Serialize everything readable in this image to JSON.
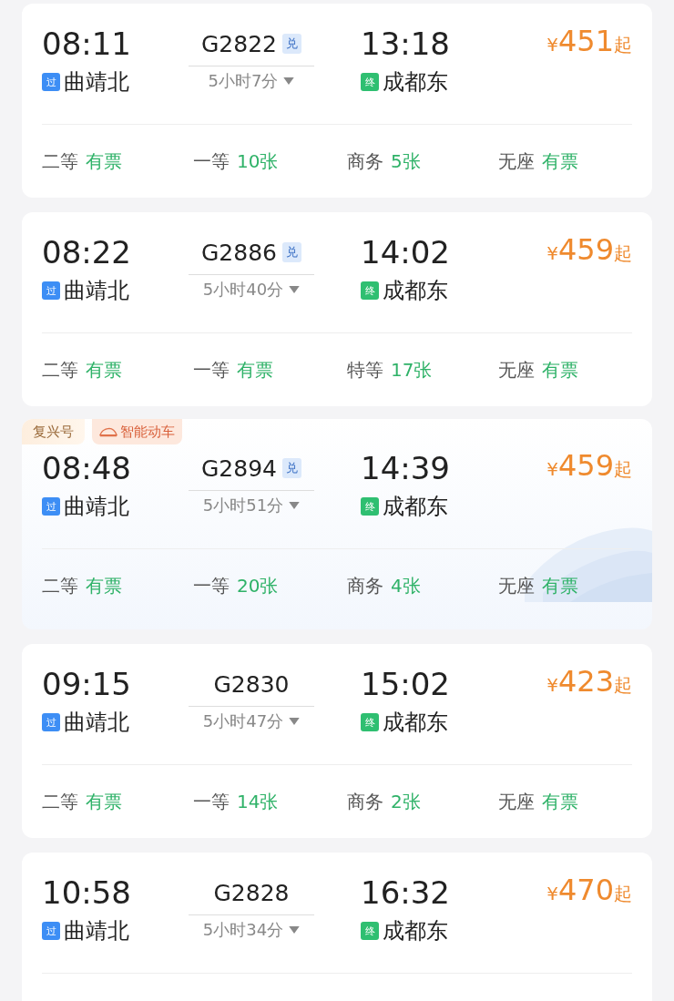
{
  "trains": [
    {
      "depart": "08:11",
      "number": "G2822",
      "badge": "兑",
      "arrive": "13:18",
      "from_tag": "过",
      "from": "曲靖北",
      "duration": "5小时7分",
      "to_tag": "终",
      "to": "成都东",
      "currency": "¥",
      "price": "451",
      "price_suffix": "起",
      "seats": [
        {
          "label": "二等",
          "availability": "有票"
        },
        {
          "label": "一等",
          "availability": "10张"
        },
        {
          "label": "商务",
          "availability": "5张"
        },
        {
          "label": "无座",
          "availability": "有票"
        }
      ]
    },
    {
      "depart": "08:22",
      "number": "G2886",
      "badge": "兑",
      "arrive": "14:02",
      "from_tag": "过",
      "from": "曲靖北",
      "duration": "5小时40分",
      "to_tag": "终",
      "to": "成都东",
      "currency": "¥",
      "price": "459",
      "price_suffix": "起",
      "seats": [
        {
          "label": "二等",
          "availability": "有票"
        },
        {
          "label": "一等",
          "availability": "有票"
        },
        {
          "label": "特等",
          "availability": "17张"
        },
        {
          "label": "无座",
          "availability": "有票"
        }
      ]
    },
    {
      "tags": [
        {
          "kind": "plain",
          "label": "复兴号"
        },
        {
          "kind": "train",
          "label": "智能动车"
        }
      ],
      "decorated": true,
      "depart": "08:48",
      "number": "G2894",
      "badge": "兑",
      "arrive": "14:39",
      "from_tag": "过",
      "from": "曲靖北",
      "duration": "5小时51分",
      "to_tag": "终",
      "to": "成都东",
      "currency": "¥",
      "price": "459",
      "price_suffix": "起",
      "seats": [
        {
          "label": "二等",
          "availability": "有票"
        },
        {
          "label": "一等",
          "availability": "20张"
        },
        {
          "label": "商务",
          "availability": "4张"
        },
        {
          "label": "无座",
          "availability": "有票"
        }
      ]
    },
    {
      "depart": "09:15",
      "number": "G2830",
      "arrive": "15:02",
      "from_tag": "过",
      "from": "曲靖北",
      "duration": "5小时47分",
      "to_tag": "终",
      "to": "成都东",
      "currency": "¥",
      "price": "423",
      "price_suffix": "起",
      "seats": [
        {
          "label": "二等",
          "availability": "有票"
        },
        {
          "label": "一等",
          "availability": "14张"
        },
        {
          "label": "商务",
          "availability": "2张"
        },
        {
          "label": "无座",
          "availability": "有票"
        }
      ]
    },
    {
      "depart": "10:58",
      "number": "G2828",
      "arrive": "16:32",
      "from_tag": "过",
      "from": "曲靖北",
      "duration": "5小时34分",
      "to_tag": "终",
      "to": "成都东",
      "currency": "¥",
      "price": "470",
      "price_suffix": "起"
    }
  ]
}
